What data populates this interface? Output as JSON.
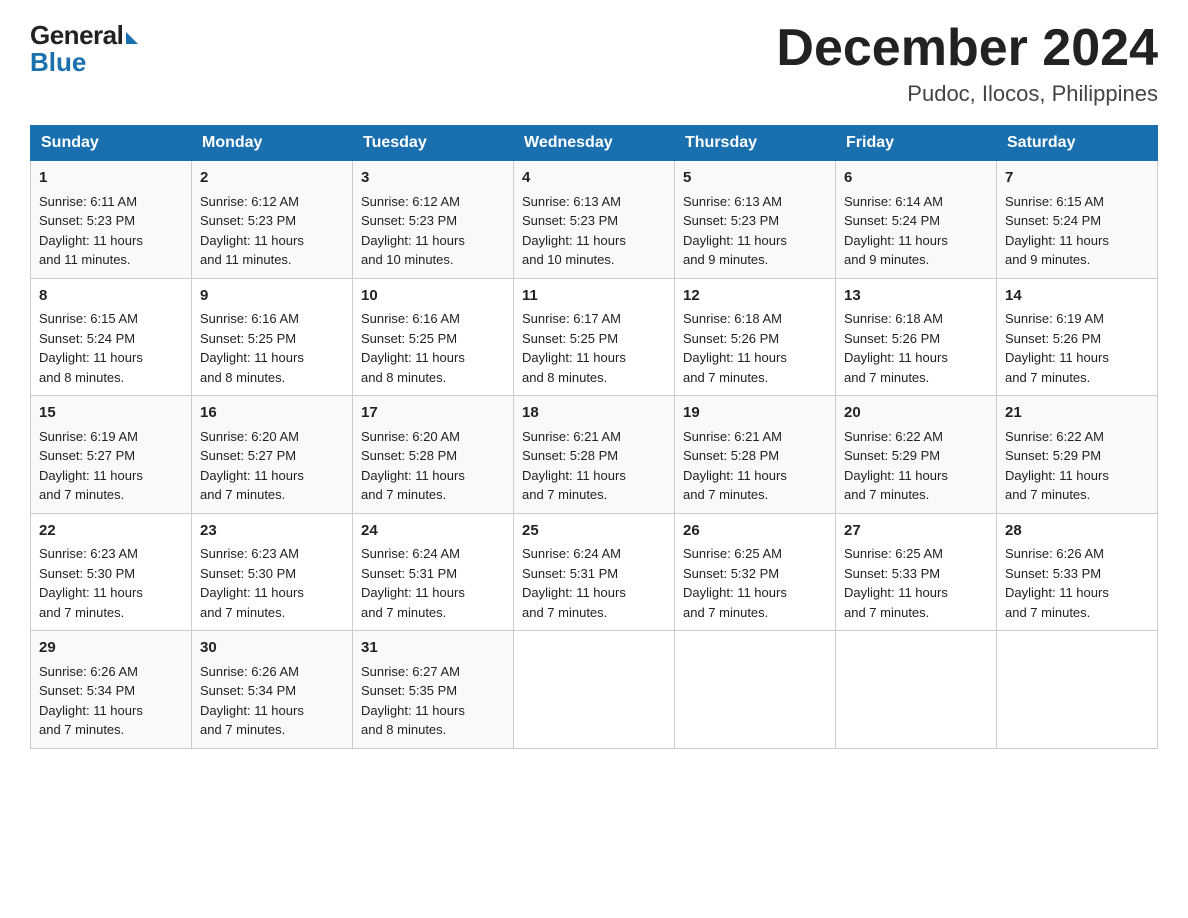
{
  "logo": {
    "general": "General",
    "blue": "Blue"
  },
  "title": {
    "month_year": "December 2024",
    "location": "Pudoc, Ilocos, Philippines"
  },
  "days_of_week": [
    "Sunday",
    "Monday",
    "Tuesday",
    "Wednesday",
    "Thursday",
    "Friday",
    "Saturday"
  ],
  "weeks": [
    [
      {
        "day": "1",
        "info": "Sunrise: 6:11 AM\nSunset: 5:23 PM\nDaylight: 11 hours\nand 11 minutes."
      },
      {
        "day": "2",
        "info": "Sunrise: 6:12 AM\nSunset: 5:23 PM\nDaylight: 11 hours\nand 11 minutes."
      },
      {
        "day": "3",
        "info": "Sunrise: 6:12 AM\nSunset: 5:23 PM\nDaylight: 11 hours\nand 10 minutes."
      },
      {
        "day": "4",
        "info": "Sunrise: 6:13 AM\nSunset: 5:23 PM\nDaylight: 11 hours\nand 10 minutes."
      },
      {
        "day": "5",
        "info": "Sunrise: 6:13 AM\nSunset: 5:23 PM\nDaylight: 11 hours\nand 9 minutes."
      },
      {
        "day": "6",
        "info": "Sunrise: 6:14 AM\nSunset: 5:24 PM\nDaylight: 11 hours\nand 9 minutes."
      },
      {
        "day": "7",
        "info": "Sunrise: 6:15 AM\nSunset: 5:24 PM\nDaylight: 11 hours\nand 9 minutes."
      }
    ],
    [
      {
        "day": "8",
        "info": "Sunrise: 6:15 AM\nSunset: 5:24 PM\nDaylight: 11 hours\nand 8 minutes."
      },
      {
        "day": "9",
        "info": "Sunrise: 6:16 AM\nSunset: 5:25 PM\nDaylight: 11 hours\nand 8 minutes."
      },
      {
        "day": "10",
        "info": "Sunrise: 6:16 AM\nSunset: 5:25 PM\nDaylight: 11 hours\nand 8 minutes."
      },
      {
        "day": "11",
        "info": "Sunrise: 6:17 AM\nSunset: 5:25 PM\nDaylight: 11 hours\nand 8 minutes."
      },
      {
        "day": "12",
        "info": "Sunrise: 6:18 AM\nSunset: 5:26 PM\nDaylight: 11 hours\nand 7 minutes."
      },
      {
        "day": "13",
        "info": "Sunrise: 6:18 AM\nSunset: 5:26 PM\nDaylight: 11 hours\nand 7 minutes."
      },
      {
        "day": "14",
        "info": "Sunrise: 6:19 AM\nSunset: 5:26 PM\nDaylight: 11 hours\nand 7 minutes."
      }
    ],
    [
      {
        "day": "15",
        "info": "Sunrise: 6:19 AM\nSunset: 5:27 PM\nDaylight: 11 hours\nand 7 minutes."
      },
      {
        "day": "16",
        "info": "Sunrise: 6:20 AM\nSunset: 5:27 PM\nDaylight: 11 hours\nand 7 minutes."
      },
      {
        "day": "17",
        "info": "Sunrise: 6:20 AM\nSunset: 5:28 PM\nDaylight: 11 hours\nand 7 minutes."
      },
      {
        "day": "18",
        "info": "Sunrise: 6:21 AM\nSunset: 5:28 PM\nDaylight: 11 hours\nand 7 minutes."
      },
      {
        "day": "19",
        "info": "Sunrise: 6:21 AM\nSunset: 5:28 PM\nDaylight: 11 hours\nand 7 minutes."
      },
      {
        "day": "20",
        "info": "Sunrise: 6:22 AM\nSunset: 5:29 PM\nDaylight: 11 hours\nand 7 minutes."
      },
      {
        "day": "21",
        "info": "Sunrise: 6:22 AM\nSunset: 5:29 PM\nDaylight: 11 hours\nand 7 minutes."
      }
    ],
    [
      {
        "day": "22",
        "info": "Sunrise: 6:23 AM\nSunset: 5:30 PM\nDaylight: 11 hours\nand 7 minutes."
      },
      {
        "day": "23",
        "info": "Sunrise: 6:23 AM\nSunset: 5:30 PM\nDaylight: 11 hours\nand 7 minutes."
      },
      {
        "day": "24",
        "info": "Sunrise: 6:24 AM\nSunset: 5:31 PM\nDaylight: 11 hours\nand 7 minutes."
      },
      {
        "day": "25",
        "info": "Sunrise: 6:24 AM\nSunset: 5:31 PM\nDaylight: 11 hours\nand 7 minutes."
      },
      {
        "day": "26",
        "info": "Sunrise: 6:25 AM\nSunset: 5:32 PM\nDaylight: 11 hours\nand 7 minutes."
      },
      {
        "day": "27",
        "info": "Sunrise: 6:25 AM\nSunset: 5:33 PM\nDaylight: 11 hours\nand 7 minutes."
      },
      {
        "day": "28",
        "info": "Sunrise: 6:26 AM\nSunset: 5:33 PM\nDaylight: 11 hours\nand 7 minutes."
      }
    ],
    [
      {
        "day": "29",
        "info": "Sunrise: 6:26 AM\nSunset: 5:34 PM\nDaylight: 11 hours\nand 7 minutes."
      },
      {
        "day": "30",
        "info": "Sunrise: 6:26 AM\nSunset: 5:34 PM\nDaylight: 11 hours\nand 7 minutes."
      },
      {
        "day": "31",
        "info": "Sunrise: 6:27 AM\nSunset: 5:35 PM\nDaylight: 11 hours\nand 8 minutes."
      },
      {
        "day": "",
        "info": ""
      },
      {
        "day": "",
        "info": ""
      },
      {
        "day": "",
        "info": ""
      },
      {
        "day": "",
        "info": ""
      }
    ]
  ]
}
